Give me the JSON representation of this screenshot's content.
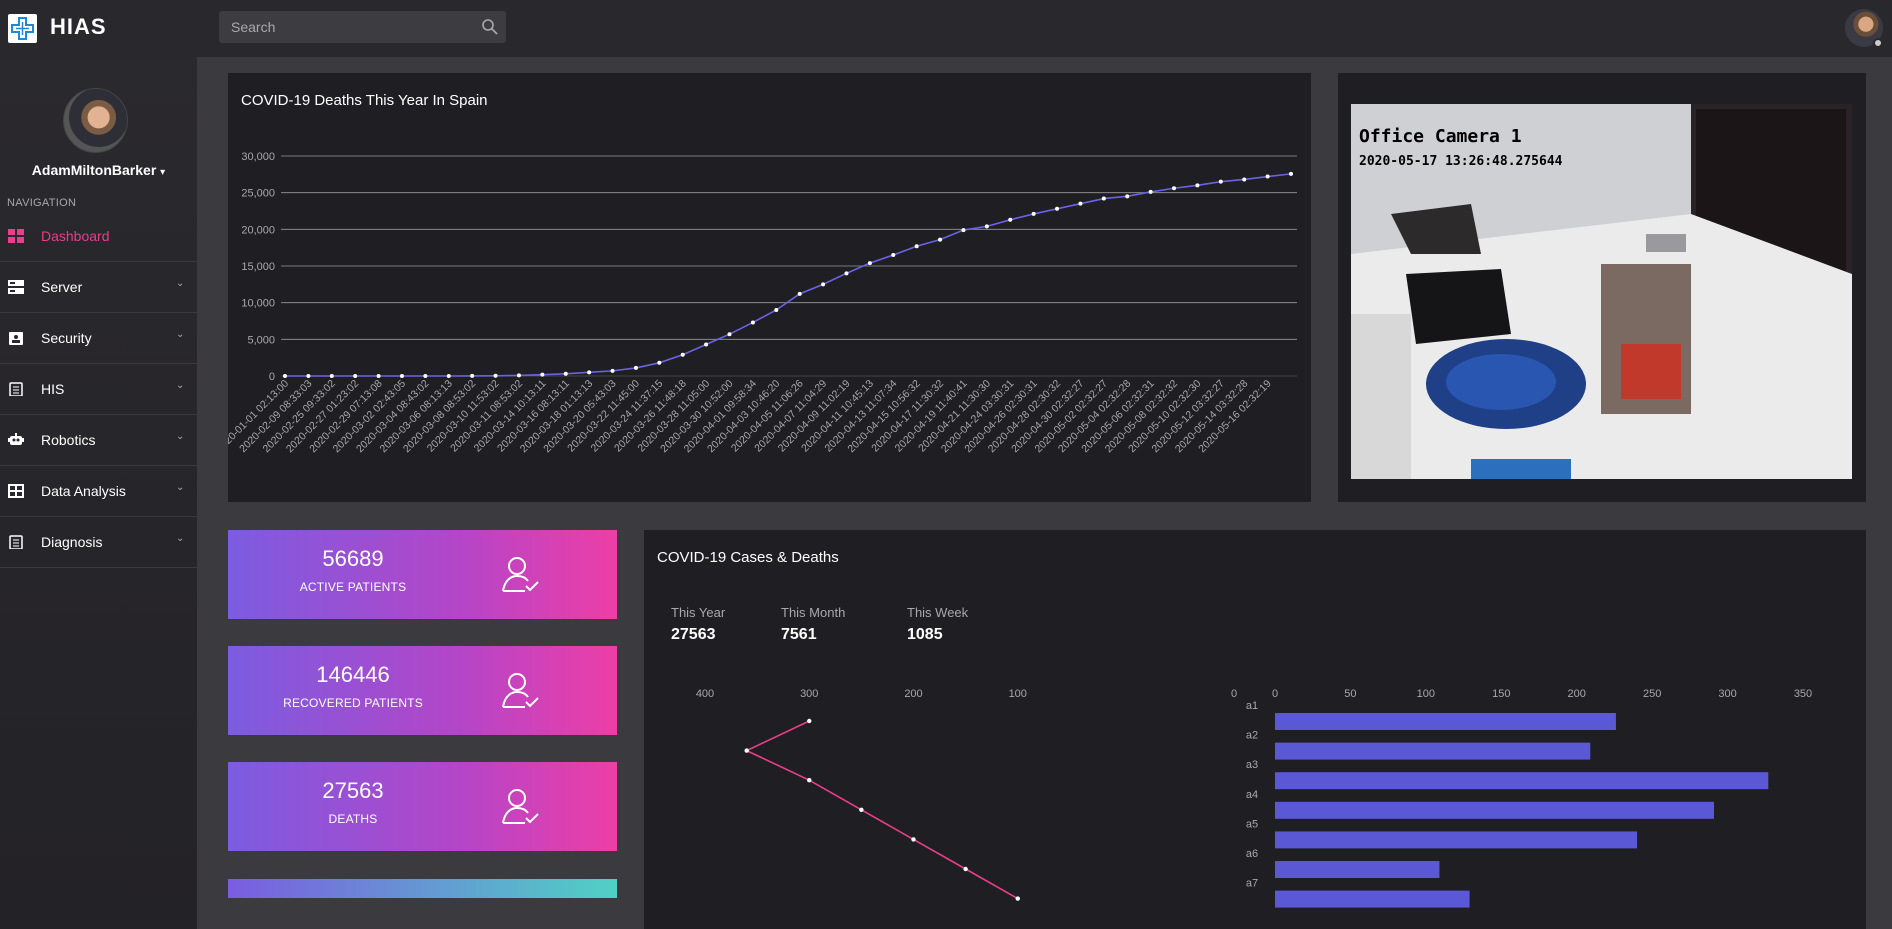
{
  "app": {
    "name": "HIAS"
  },
  "search": {
    "placeholder": "Search"
  },
  "sidebar": {
    "user_name": "AdamMiltonBarker",
    "nav_heading": "NAVIGATION",
    "items": [
      {
        "label": "Dashboard",
        "icon": "dashboard-icon",
        "active": true
      },
      {
        "label": "Server",
        "icon": "server-icon"
      },
      {
        "label": "Security",
        "icon": "id-badge-icon"
      },
      {
        "label": "HIS",
        "icon": "clipboard-icon"
      },
      {
        "label": "Robotics",
        "icon": "robot-icon"
      },
      {
        "label": "Data Analysis",
        "icon": "table-icon"
      },
      {
        "label": "Diagnosis",
        "icon": "clipboard-icon"
      }
    ]
  },
  "deaths_panel": {
    "title": "COVID-19 Deaths This Year In Spain"
  },
  "camera": {
    "title": "Office Camera 1",
    "timestamp": "2020-05-17 13:26:48.275644"
  },
  "stats": [
    {
      "value": "56689",
      "label": "ACTIVE PATIENTS"
    },
    {
      "value": "146446",
      "label": "RECOVERED PATIENTS"
    },
    {
      "value": "27563",
      "label": "DEATHS"
    }
  ],
  "cases_panel": {
    "title": "COVID-19 Cases & Deaths",
    "summary": [
      {
        "label": "This Year",
        "value": "27563"
      },
      {
        "label": "This Month",
        "value": "7561"
      },
      {
        "label": "This Week",
        "value": "1085"
      }
    ]
  },
  "colors": {
    "accent": "#e83e8c",
    "line": "#6a63e6",
    "bar": "#5b58d6",
    "panel": "#1f1e22"
  },
  "chart_data": [
    {
      "type": "line",
      "title": "COVID-19 Deaths This Year In Spain",
      "ylim": [
        0,
        30000
      ],
      "y_ticks": [
        "0",
        "5,000",
        "10,000",
        "15,000",
        "20,000",
        "25,000",
        "30,000"
      ],
      "grid": true,
      "x": [
        "2020-01-01 02:13:00",
        "2020-02-09 08:33:03",
        "2020-02-25 09:33:02",
        "2020-02-27 01:23:02",
        "2020-02-29 07:13:08",
        "2020-03-02 02:43:05",
        "2020-03-04 08:43:02",
        "2020-03-06 08:13:13",
        "2020-03-08 08:53:02",
        "2020-03-10 11:53:02",
        "2020-03-11 08:53:02",
        "2020-03-14 10:13:11",
        "2020-03-16 08:13:11",
        "2020-03-18 01:13:13",
        "2020-03-20 05:43:03",
        "2020-03-22 11:45:00",
        "2020-03-24 11:37:15",
        "2020-03-26 11:48:18",
        "2020-03-28 11:05:00",
        "2020-03-30 10:52:00",
        "2020-04-01 09:58:34",
        "2020-04-03 10:46:20",
        "2020-04-05 11:06:26",
        "2020-04-07 11:04:29",
        "2020-04-09 11:02:19",
        "2020-04-11 10:45:13",
        "2020-04-13 11:07:34",
        "2020-04-15 10:56:32",
        "2020-04-17 11:30:32",
        "2020-04-19 11:40:41",
        "2020-04-21 11:30:30",
        "2020-04-24 03:30:31",
        "2020-04-26 02:30:31",
        "2020-04-28 02:30:32",
        "2020-04-30 02:32:27",
        "2020-05-02 02:32:27",
        "2020-05-04 02:32:28",
        "2020-05-06 02:32:31",
        "2020-05-08 02:32:32",
        "2020-05-10 02:32:30",
        "2020-05-12 03:32:27",
        "2020-05-14 03:32:28",
        "2020-05-16 02:32:19"
      ],
      "values": [
        0,
        0,
        0,
        0,
        0,
        0,
        0,
        0,
        10,
        30,
        80,
        180,
        300,
        500,
        700,
        1100,
        1800,
        2900,
        4300,
        5700,
        7300,
        9000,
        11200,
        12500,
        14000,
        15400,
        16500,
        17700,
        18600,
        19900,
        20400,
        21300,
        22100,
        22800,
        23500,
        24200,
        24500,
        25100,
        25600,
        26000,
        26500,
        26800,
        27200,
        27563
      ]
    },
    {
      "type": "line",
      "x_ticks": [
        400,
        300,
        200,
        100
      ],
      "xlim": [
        400,
        0
      ],
      "values": [
        300,
        360,
        300,
        250,
        200,
        150,
        100
      ]
    },
    {
      "type": "bar",
      "orientation": "horizontal",
      "categories": [
        "a1",
        "a2",
        "a3",
        "a4",
        "a5",
        "a6",
        "a7"
      ],
      "values": [
        226,
        209,
        327,
        291,
        240,
        109,
        129
      ],
      "x_ticks": [
        0,
        50,
        100,
        150,
        200,
        250,
        300,
        350
      ],
      "xlim": [
        0,
        350
      ]
    }
  ]
}
